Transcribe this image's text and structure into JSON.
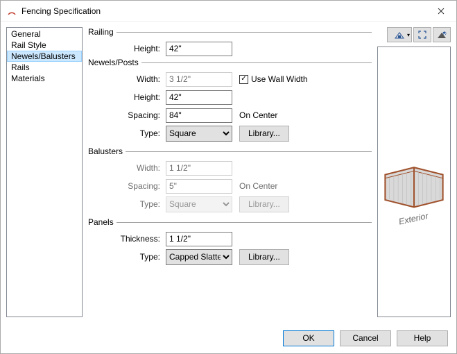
{
  "window": {
    "title": "Fencing Specification"
  },
  "nav": {
    "items": [
      {
        "label": "General"
      },
      {
        "label": "Rail Style"
      },
      {
        "label": "Newels/Balusters",
        "selected": true
      },
      {
        "label": "Rails"
      },
      {
        "label": "Materials"
      }
    ]
  },
  "groups": {
    "railing": {
      "title": "Railing",
      "height": {
        "label": "Height:",
        "value": "42\""
      }
    },
    "newels": {
      "title": "Newels/Posts",
      "width": {
        "label": "Width:",
        "value": "3 1/2\"",
        "disabled": true
      },
      "use_wall_width": {
        "label": "Use Wall Width",
        "checked": true
      },
      "height": {
        "label": "Height:",
        "value": "42\""
      },
      "spacing": {
        "label": "Spacing:",
        "value": "84\"",
        "suffix": "On Center"
      },
      "type": {
        "label": "Type:",
        "value": "Square",
        "library": "Library..."
      }
    },
    "balusters": {
      "title": "Balusters",
      "width": {
        "label": "Width:",
        "value": "1 1/2\""
      },
      "spacing": {
        "label": "Spacing:",
        "value": "5\"",
        "suffix": "On Center"
      },
      "type": {
        "label": "Type:",
        "value": "Square",
        "library": "Library..."
      }
    },
    "panels": {
      "title": "Panels",
      "thickness": {
        "label": "Thickness:",
        "value": "1 1/2\""
      },
      "type": {
        "label": "Type:",
        "value": "Capped Slatted",
        "library": "Library..."
      }
    }
  },
  "preview": {
    "caption": "Exterior"
  },
  "footer": {
    "ok": "OK",
    "cancel": "Cancel",
    "help": "Help"
  }
}
